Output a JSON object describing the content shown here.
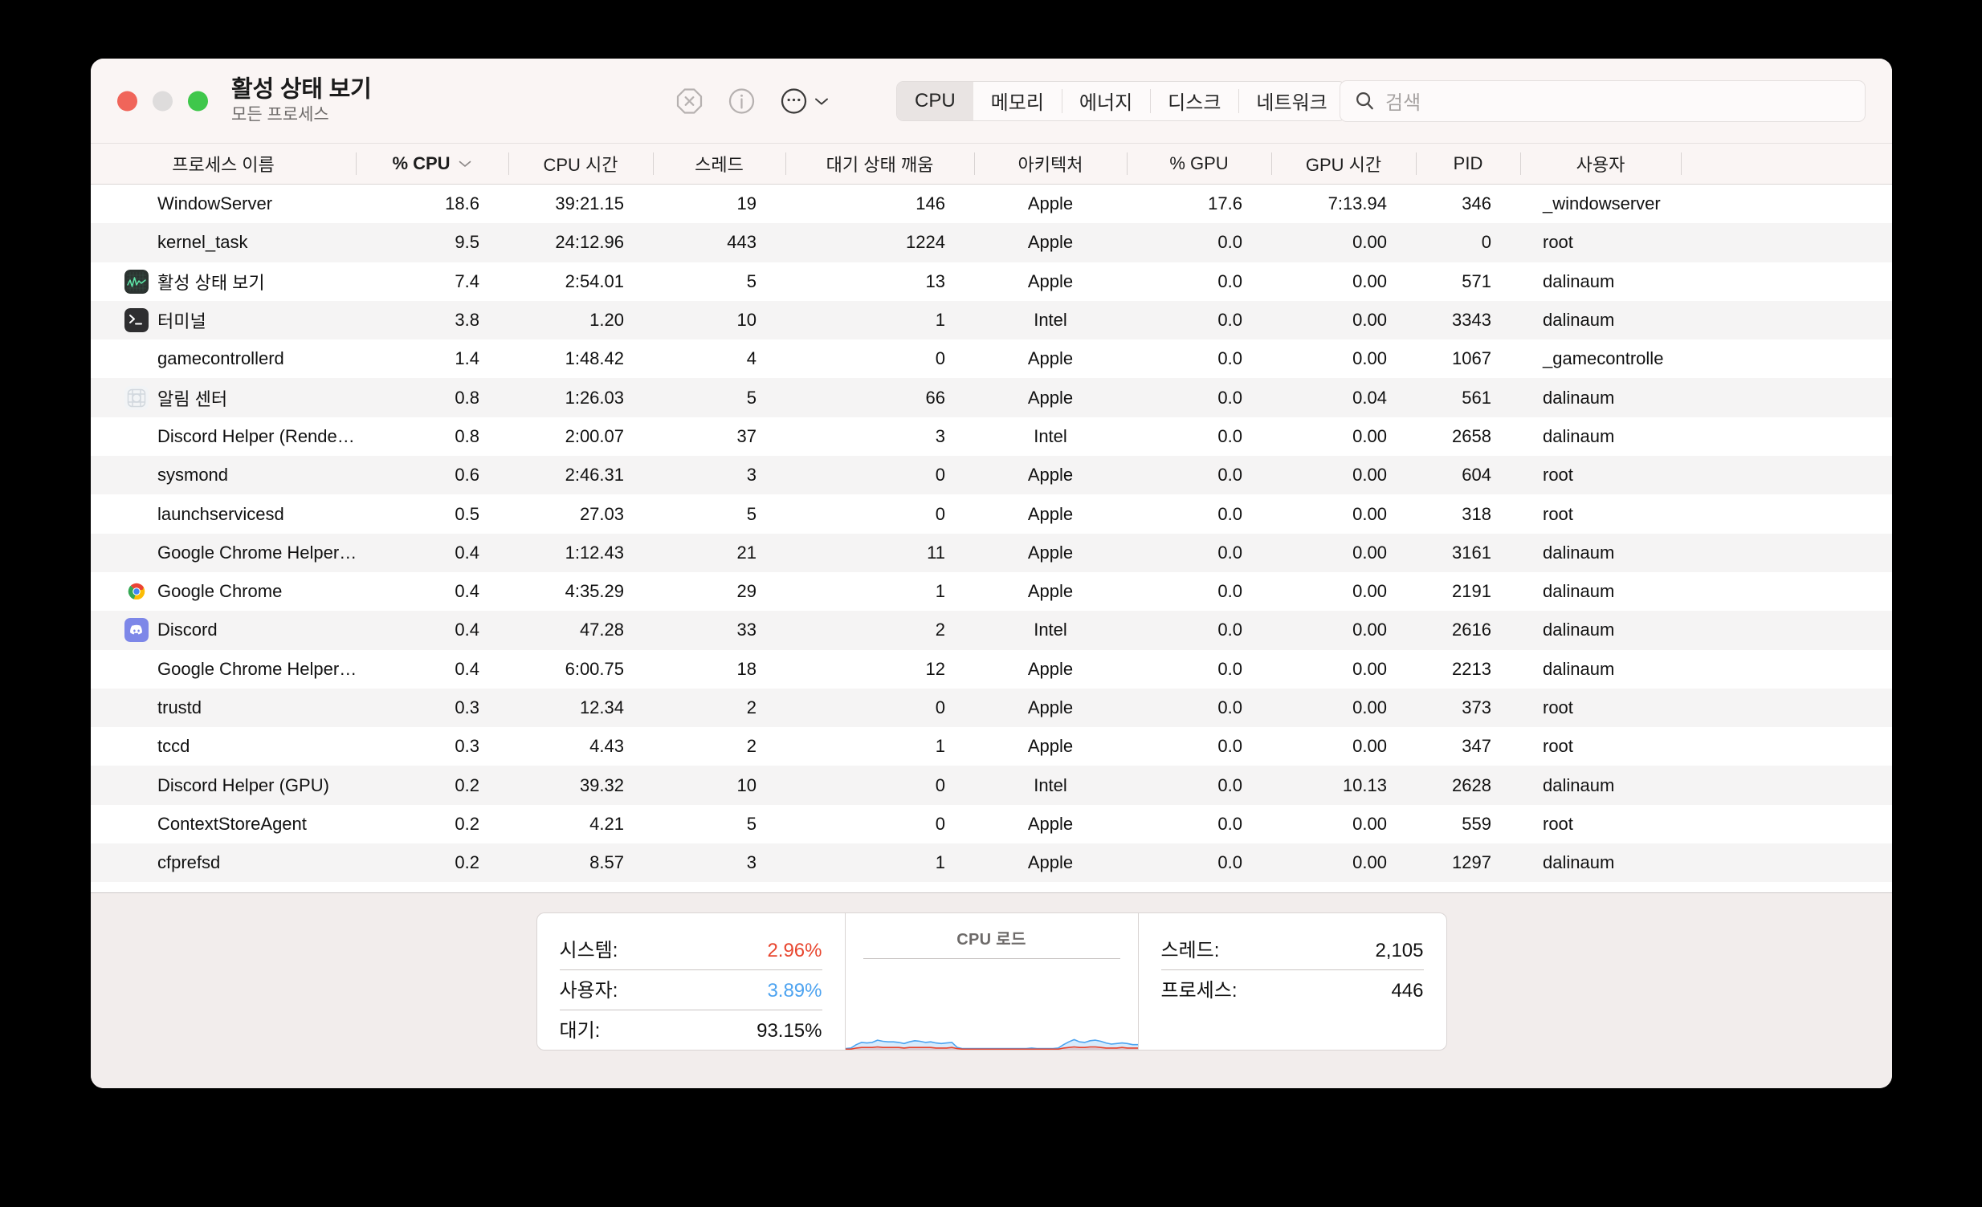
{
  "window": {
    "title": "활성 상태 보기",
    "subtitle": "모든 프로세스"
  },
  "toolbar": {
    "quit_process_icon": "octagon-x-icon",
    "inspect_icon": "info-circle-icon",
    "more_icon": "ellipsis-circle-icon",
    "more_chevron_icon": "chevron-down-icon",
    "tabs": [
      {
        "label": "CPU",
        "active": true
      },
      {
        "label": "메모리",
        "active": false
      },
      {
        "label": "에너지",
        "active": false
      },
      {
        "label": "디스크",
        "active": false
      },
      {
        "label": "네트워크",
        "active": false
      }
    ],
    "search": {
      "placeholder": "검색",
      "value": "",
      "icon": "search-icon"
    }
  },
  "table": {
    "columns": [
      {
        "key": "name",
        "label": "프로세스 이름",
        "sorted": false
      },
      {
        "key": "cpu",
        "label": "% CPU",
        "sorted": true,
        "sort_icon": "chevron-down-icon"
      },
      {
        "key": "cpu_time",
        "label": "CPU 시간",
        "sorted": false
      },
      {
        "key": "threads",
        "label": "스레드",
        "sorted": false
      },
      {
        "key": "idle_wake",
        "label": "대기 상태 깨움",
        "sorted": false
      },
      {
        "key": "arch",
        "label": "아키텍처",
        "sorted": false
      },
      {
        "key": "gpu",
        "label": "% GPU",
        "sorted": false
      },
      {
        "key": "gpu_time",
        "label": "GPU 시간",
        "sorted": false
      },
      {
        "key": "pid",
        "label": "PID",
        "sorted": false
      },
      {
        "key": "user",
        "label": "사용자",
        "sorted": false
      }
    ],
    "rows": [
      {
        "icon": null,
        "name": "WindowServer",
        "cpu": "18.6",
        "cpu_time": "39:21.15",
        "threads": "19",
        "idle_wake": "146",
        "arch": "Apple",
        "gpu": "17.6",
        "gpu_time": "7:13.94",
        "pid": "346",
        "user": "_windowserver"
      },
      {
        "icon": null,
        "name": "kernel_task",
        "cpu": "9.5",
        "cpu_time": "24:12.96",
        "threads": "443",
        "idle_wake": "1224",
        "arch": "Apple",
        "gpu": "0.0",
        "gpu_time": "0.00",
        "pid": "0",
        "user": "root"
      },
      {
        "icon": "activity-monitor-icon",
        "name": "활성 상태 보기",
        "cpu": "7.4",
        "cpu_time": "2:54.01",
        "threads": "5",
        "idle_wake": "13",
        "arch": "Apple",
        "gpu": "0.0",
        "gpu_time": "0.00",
        "pid": "571",
        "user": "dalinaum"
      },
      {
        "icon": "terminal-icon",
        "name": "터미널",
        "cpu": "3.8",
        "cpu_time": "1.20",
        "threads": "10",
        "idle_wake": "1",
        "arch": "Intel",
        "gpu": "0.0",
        "gpu_time": "0.00",
        "pid": "3343",
        "user": "dalinaum"
      },
      {
        "icon": null,
        "name": "gamecontrollerd",
        "cpu": "1.4",
        "cpu_time": "1:48.42",
        "threads": "4",
        "idle_wake": "0",
        "arch": "Apple",
        "gpu": "0.0",
        "gpu_time": "0.00",
        "pid": "1067",
        "user": "_gamecontrolle"
      },
      {
        "icon": "notification-center-icon",
        "name": "알림 센터",
        "cpu": "0.8",
        "cpu_time": "1:26.03",
        "threads": "5",
        "idle_wake": "66",
        "arch": "Apple",
        "gpu": "0.0",
        "gpu_time": "0.04",
        "pid": "561",
        "user": "dalinaum"
      },
      {
        "icon": null,
        "name": "Discord Helper (Rende…",
        "cpu": "0.8",
        "cpu_time": "2:00.07",
        "threads": "37",
        "idle_wake": "3",
        "arch": "Intel",
        "gpu": "0.0",
        "gpu_time": "0.00",
        "pid": "2658",
        "user": "dalinaum"
      },
      {
        "icon": null,
        "name": "sysmond",
        "cpu": "0.6",
        "cpu_time": "2:46.31",
        "threads": "3",
        "idle_wake": "0",
        "arch": "Apple",
        "gpu": "0.0",
        "gpu_time": "0.00",
        "pid": "604",
        "user": "root"
      },
      {
        "icon": null,
        "name": "launchservicesd",
        "cpu": "0.5",
        "cpu_time": "27.03",
        "threads": "5",
        "idle_wake": "0",
        "arch": "Apple",
        "gpu": "0.0",
        "gpu_time": "0.00",
        "pid": "318",
        "user": "root"
      },
      {
        "icon": null,
        "name": "Google Chrome Helper…",
        "cpu": "0.4",
        "cpu_time": "1:12.43",
        "threads": "21",
        "idle_wake": "11",
        "arch": "Apple",
        "gpu": "0.0",
        "gpu_time": "0.00",
        "pid": "3161",
        "user": "dalinaum"
      },
      {
        "icon": "chrome-icon",
        "name": "Google Chrome",
        "cpu": "0.4",
        "cpu_time": "4:35.29",
        "threads": "29",
        "idle_wake": "1",
        "arch": "Apple",
        "gpu": "0.0",
        "gpu_time": "0.00",
        "pid": "2191",
        "user": "dalinaum"
      },
      {
        "icon": "discord-icon",
        "name": "Discord",
        "cpu": "0.4",
        "cpu_time": "47.28",
        "threads": "33",
        "idle_wake": "2",
        "arch": "Intel",
        "gpu": "0.0",
        "gpu_time": "0.00",
        "pid": "2616",
        "user": "dalinaum"
      },
      {
        "icon": null,
        "name": "Google Chrome Helper…",
        "cpu": "0.4",
        "cpu_time": "6:00.75",
        "threads": "18",
        "idle_wake": "12",
        "arch": "Apple",
        "gpu": "0.0",
        "gpu_time": "0.00",
        "pid": "2213",
        "user": "dalinaum"
      },
      {
        "icon": null,
        "name": "trustd",
        "cpu": "0.3",
        "cpu_time": "12.34",
        "threads": "2",
        "idle_wake": "0",
        "arch": "Apple",
        "gpu": "0.0",
        "gpu_time": "0.00",
        "pid": "373",
        "user": "root"
      },
      {
        "icon": null,
        "name": "tccd",
        "cpu": "0.3",
        "cpu_time": "4.43",
        "threads": "2",
        "idle_wake": "1",
        "arch": "Apple",
        "gpu": "0.0",
        "gpu_time": "0.00",
        "pid": "347",
        "user": "root"
      },
      {
        "icon": null,
        "name": "Discord Helper (GPU)",
        "cpu": "0.2",
        "cpu_time": "39.32",
        "threads": "10",
        "idle_wake": "0",
        "arch": "Intel",
        "gpu": "0.0",
        "gpu_time": "10.13",
        "pid": "2628",
        "user": "dalinaum"
      },
      {
        "icon": null,
        "name": "ContextStoreAgent",
        "cpu": "0.2",
        "cpu_time": "4.21",
        "threads": "5",
        "idle_wake": "0",
        "arch": "Apple",
        "gpu": "0.0",
        "gpu_time": "0.00",
        "pid": "559",
        "user": "root"
      },
      {
        "icon": null,
        "name": "cfprefsd",
        "cpu": "0.2",
        "cpu_time": "8.57",
        "threads": "3",
        "idle_wake": "1",
        "arch": "Apple",
        "gpu": "0.0",
        "gpu_time": "0.00",
        "pid": "1297",
        "user": "dalinaum"
      }
    ]
  },
  "dashboard": {
    "cpu_stats": [
      {
        "label": "시스템:",
        "value": "2.96%",
        "color_class": "red"
      },
      {
        "label": "사용자:",
        "value": "3.89%",
        "color_class": "blue"
      },
      {
        "label": "대기:",
        "value": "93.15%",
        "color_class": ""
      }
    ],
    "counts": [
      {
        "label": "스레드:",
        "value": "2,105"
      },
      {
        "label": "프로세스:",
        "value": "446"
      }
    ],
    "graph": {
      "title": "CPU 로드"
    }
  },
  "chart_data": {
    "type": "area",
    "title": "CPU 로드",
    "ylabel": "",
    "xlabel": "",
    "ylim": [
      0,
      100
    ],
    "grid": false,
    "legend": "none",
    "series": [
      {
        "name": "사용자",
        "color": "#4da3f0",
        "values": [
          2,
          3,
          9,
          13,
          12,
          13,
          17,
          15,
          14,
          14,
          13,
          11,
          14,
          16,
          15,
          13,
          14,
          12,
          11,
          12,
          13,
          4,
          2,
          2,
          2,
          2,
          2,
          2,
          2,
          2,
          2,
          2,
          2,
          2,
          2,
          3,
          2,
          2,
          2,
          2,
          3,
          9,
          14,
          18,
          14,
          13,
          16,
          17,
          15,
          12,
          10,
          11,
          12,
          11,
          9,
          9
        ]
      },
      {
        "name": "시스템",
        "color": "#e8462f",
        "values": [
          1,
          1,
          3,
          4,
          4,
          4,
          5,
          4,
          4,
          4,
          4,
          3,
          4,
          4,
          4,
          4,
          4,
          3,
          3,
          3,
          4,
          2,
          1,
          1,
          1,
          1,
          1,
          1,
          1,
          1,
          1,
          1,
          1,
          1,
          1,
          1,
          1,
          1,
          1,
          1,
          1,
          3,
          4,
          5,
          4,
          4,
          5,
          5,
          4,
          3,
          3,
          3,
          4,
          3,
          3,
          3
        ]
      }
    ]
  }
}
